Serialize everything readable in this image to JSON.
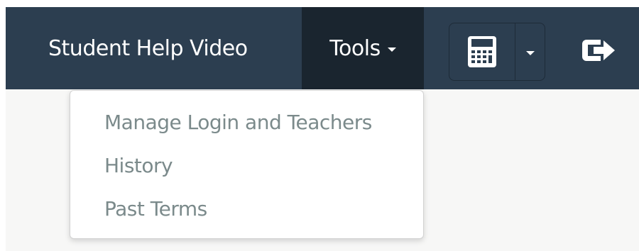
{
  "navbar": {
    "help_label": "Student Help Video",
    "tools_label": "Tools",
    "calculator_icon": "calculator-icon",
    "logout_icon": "sign-out-icon"
  },
  "tools_menu": {
    "items": [
      {
        "label": "Manage Login and Teachers"
      },
      {
        "label": "History"
      },
      {
        "label": "Past Terms"
      }
    ]
  },
  "colors": {
    "navbar_bg": "#2c3e50",
    "active_tab_bg": "#1a252f",
    "menu_text": "#7b8a8b",
    "page_bg": "#f7f7f6"
  }
}
